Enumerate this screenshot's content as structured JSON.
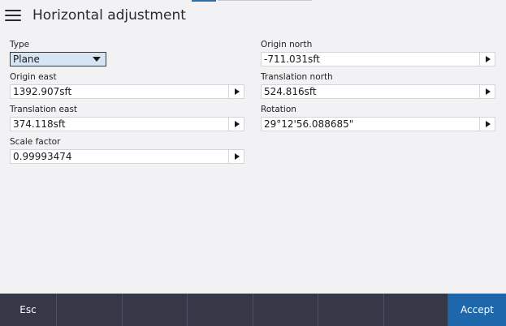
{
  "header": {
    "title": "Horizontal adjustment",
    "menu_icon": "hamburger-menu-icon"
  },
  "form": {
    "type": {
      "label": "Type",
      "value": "Plane"
    },
    "origin_north": {
      "label": "Origin north",
      "value": "-711.031sft"
    },
    "origin_east": {
      "label": "Origin east",
      "value": "1392.907sft"
    },
    "translation_north": {
      "label": "Translation north",
      "value": "524.816sft"
    },
    "translation_east": {
      "label": "Translation east",
      "value": "374.118sft"
    },
    "rotation": {
      "label": "Rotation",
      "value": "29°12'56.088685\""
    },
    "scale_factor": {
      "label": "Scale factor",
      "value": "0.99993474"
    }
  },
  "footer": {
    "esc_label": "Esc",
    "accept_label": "Accept"
  },
  "colors": {
    "background": "#f2f2f5",
    "footer": "#363747",
    "accept": "#1e67ab",
    "select_highlight": "#d6e4f3"
  }
}
